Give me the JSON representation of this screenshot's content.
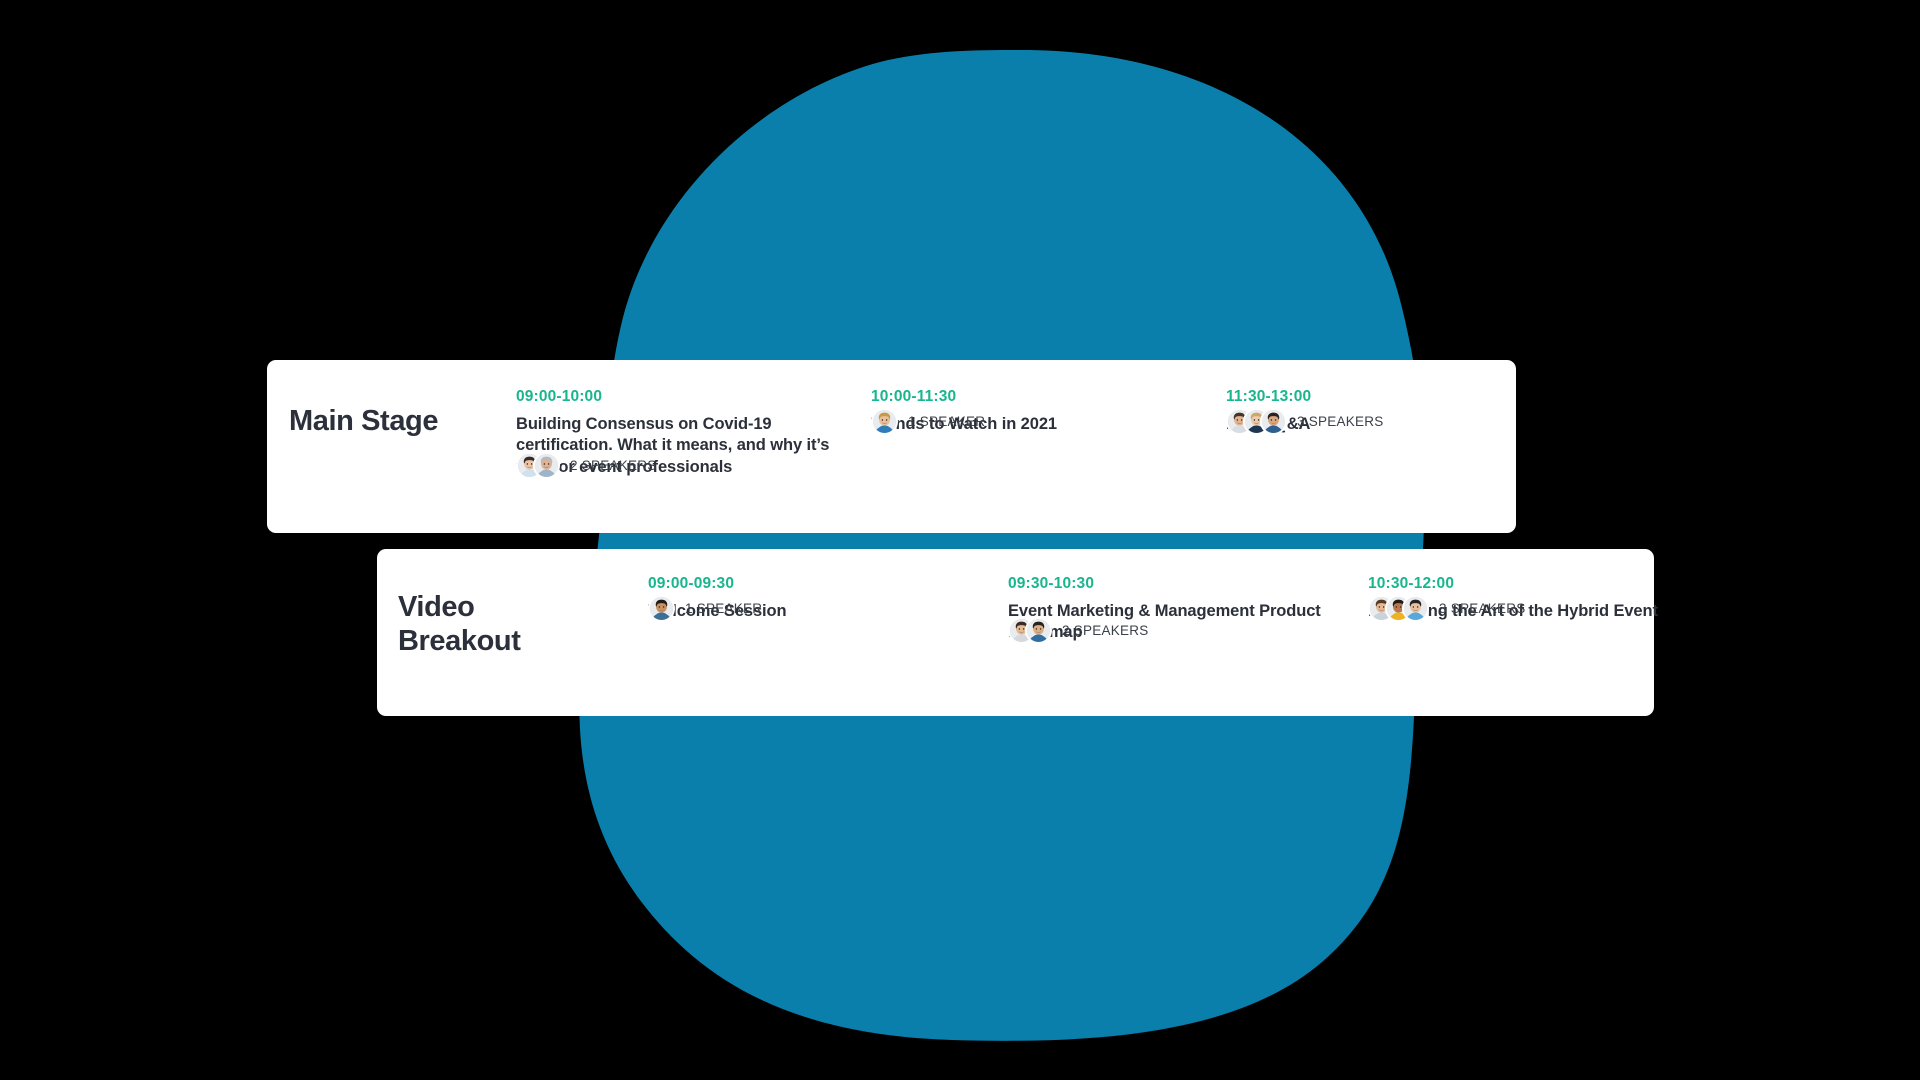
{
  "theme": {
    "page_background": "#000000",
    "blob_color": "#0a7fab",
    "card_background": "#ffffff",
    "time_color": "#18b68e",
    "title_color": "#2b303a",
    "speaker_text_color": "#3b4049"
  },
  "tracks": [
    {
      "id": "main-stage",
      "name": "Main Stage",
      "sessions": [
        {
          "time": "09:00-10:00",
          "title": "Building Consensus on Covid-19 certification. What it means, and why it’s vital for event professionals",
          "speaker_count_label": "2 SPEAKERS",
          "speakers": [
            {
              "name": "speaker-avatar-1",
              "skin": "#e8c4a8",
              "hair": "#3a2a22",
              "shirt": "#cfe0ee"
            },
            {
              "name": "speaker-avatar-2",
              "skin": "#dcb394",
              "hair": "#b9b9bb",
              "shirt": "#9fb4c6"
            }
          ]
        },
        {
          "time": "10:00-11:30",
          "title": "Trends to Watch in 2021",
          "speaker_count_label": "1 SPEAKER",
          "speakers": [
            {
              "name": "speaker-avatar-3",
              "skin": "#e8c09a",
              "hair": "#c59a4f",
              "shirt": "#2e7cb8"
            }
          ]
        },
        {
          "time": "11:30-13:00",
          "title": "Panel Q&A",
          "speaker_count_label": "3 SPEAKERS",
          "speakers": [
            {
              "name": "speaker-avatar-4",
              "skin": "#e0b493",
              "hair": "#4a3228",
              "shirt": "#d8dde3"
            },
            {
              "name": "speaker-avatar-5",
              "skin": "#eccaab",
              "hair": "#caa86c",
              "shirt": "#1f3650"
            },
            {
              "name": "speaker-avatar-6",
              "skin": "#d8a77f",
              "hair": "#2c2320",
              "shirt": "#2f5f8f"
            }
          ]
        }
      ]
    },
    {
      "id": "video-breakout",
      "name": "Video Breakout",
      "sessions": [
        {
          "time": "09:00-09:30",
          "title": "Welcome Session",
          "speaker_count_label": "1 SPEAKER",
          "speakers": [
            {
              "name": "speaker-avatar-7",
              "skin": "#c9915f",
              "hair": "#241a16",
              "shirt": "#3c6f95"
            }
          ]
        },
        {
          "time": "09:30-10:30",
          "title": "Event Marketing & Management Product Roadmap",
          "speaker_count_label": "2 SPEAKERS",
          "speakers": [
            {
              "name": "speaker-avatar-8",
              "skin": "#e4bb96",
              "hair": "#3b2b22",
              "shirt": "#d5d9de"
            },
            {
              "name": "speaker-avatar-9",
              "skin": "#dcae86",
              "hair": "#2a201c",
              "shirt": "#2f6ea3"
            }
          ]
        },
        {
          "time": "10:30-12:00",
          "title": "Perfecting the Art of the Hybrid Event",
          "speaker_count_label": "3 SPEAKERS",
          "speakers": [
            {
              "name": "speaker-avatar-10",
              "skin": "#e3ba96",
              "hair": "#5a3a23",
              "shirt": "#c9d3dc"
            },
            {
              "name": "speaker-avatar-11",
              "skin": "#b9794a",
              "hair": "#231a15",
              "shirt": "#efb21f"
            },
            {
              "name": "speaker-avatar-12",
              "skin": "#e6c3a0",
              "hair": "#2a2320",
              "shirt": "#58a8d8"
            }
          ]
        }
      ]
    }
  ]
}
